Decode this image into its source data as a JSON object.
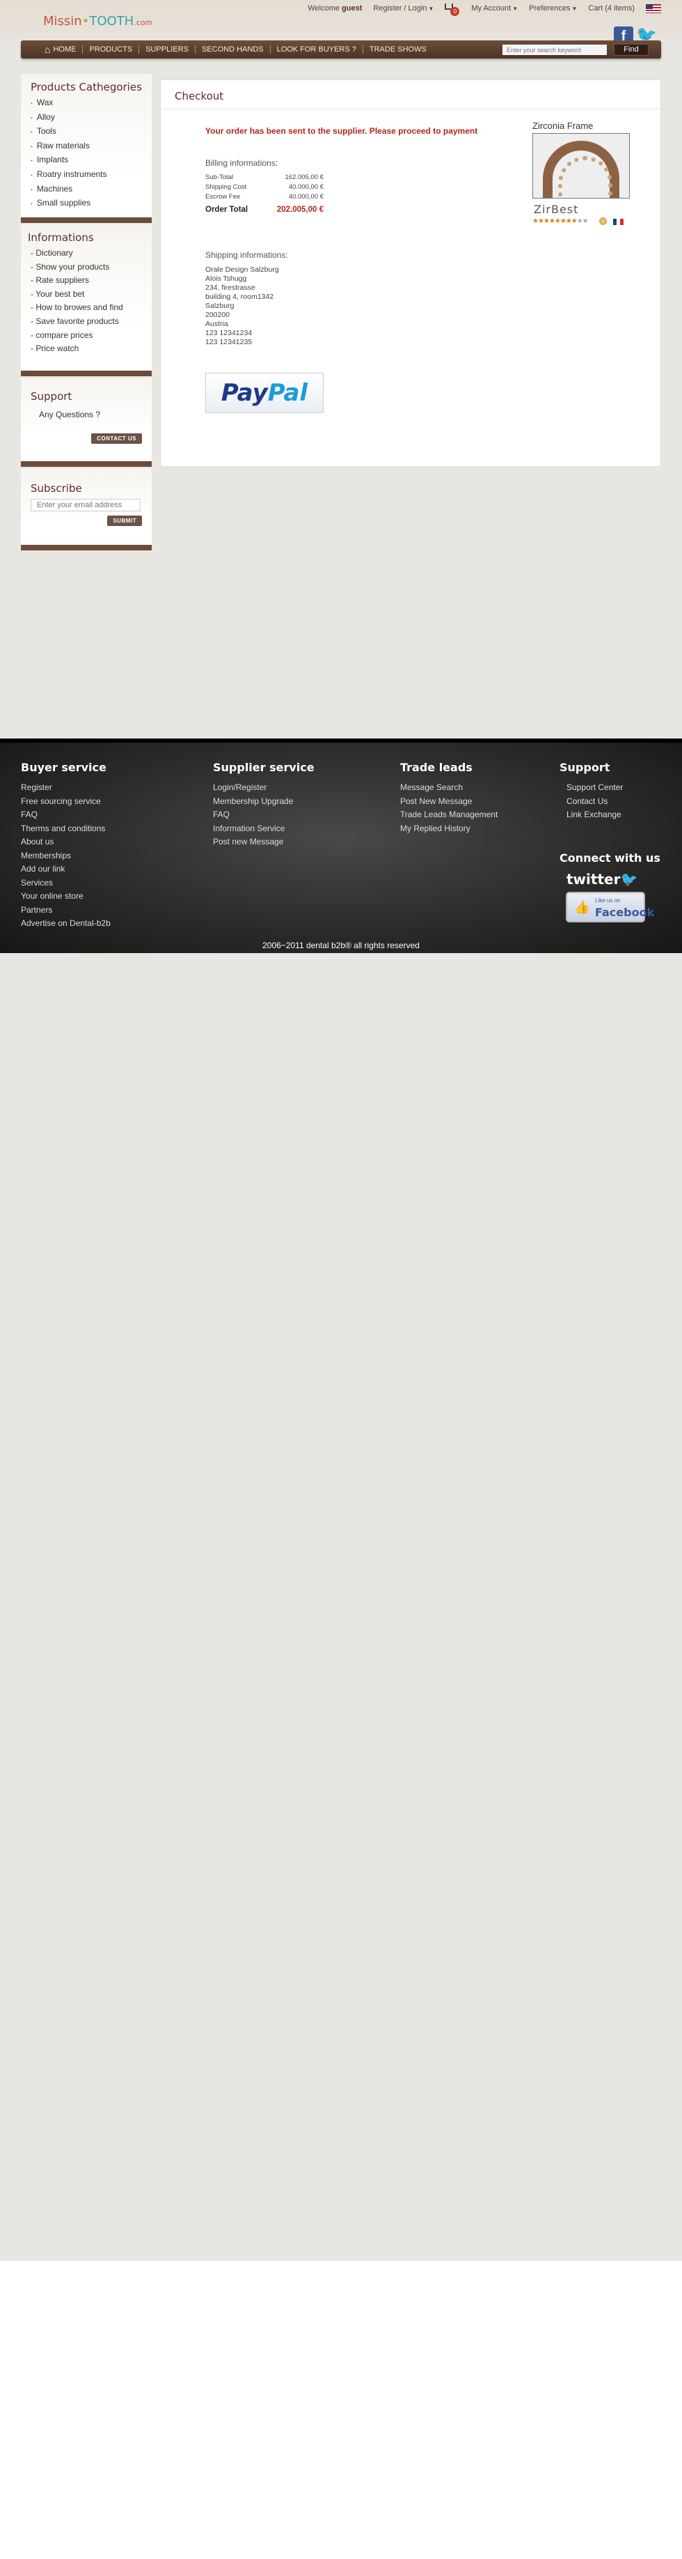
{
  "header": {
    "logo": {
      "part1": "Missin",
      "dot": "•",
      "part2": "TOOTH",
      "suffix": ".com"
    },
    "welcome_prefix": "Welcome",
    "welcome_user": "guest",
    "register_login": "Register / Login",
    "cart_badge": "0",
    "my_account": "My Account",
    "preferences": "Preferences",
    "cart": "Cart (4 items)",
    "fb_label": "f",
    "tw_label": "🐦"
  },
  "nav": {
    "home": "HOME",
    "items": [
      "PRODUCTS",
      "SUPPLIERS",
      "SECOND HANDS",
      "LOOK FOR BUYERS ?",
      "TRADE SHOWS"
    ],
    "search_placeholder": "Enter your search keyword",
    "find": "Find"
  },
  "sidebar": {
    "categories_title": "Products Cathegories",
    "categories": [
      "Wax",
      "Alloy",
      "Tools",
      "Raw materials",
      "Implants",
      "Roatry instruments",
      "Machines",
      "Small supplies"
    ],
    "info_title": "Informations",
    "info_items": [
      "- Dictionary",
      "- Show your products",
      "- Rate suppliers",
      "- Your best bet",
      "- How to browes and find",
      "- Save favorite products",
      "- compare prices",
      "- Price watch"
    ],
    "support_title": "Support",
    "support_question": "Any Questions ?",
    "contact_button": "CONTACT US",
    "subscribe_title": "Subscribe",
    "subscribe_placeholder": "Enter your email address",
    "submit_button": "SUBMIT"
  },
  "checkout": {
    "title": "Checkout",
    "message": "Your order has been sent to the supplier. Please proceed to payment",
    "billing_label": "Billing informations:",
    "billing": [
      {
        "label": "Sub-Total",
        "value": "162.005,00 €"
      },
      {
        "label": "Shipping Cost",
        "value": "40.000,00 €"
      },
      {
        "label": "Escrow Fee",
        "value": "40.000,00 €"
      }
    ],
    "total_label": "Order Total",
    "total_value": "202.005,00 €",
    "shipping_label": "Shipping informations:",
    "shipping_lines": [
      "Orale Design Salzburg",
      "Alois Tshugg",
      "234, firestrasse",
      "building 4, room1342",
      "Salzburg",
      "200200",
      "Austria",
      "123 12341234",
      "123 12341235"
    ],
    "paypal_part1": "Pay",
    "paypal_part2": "Pal"
  },
  "product": {
    "name": "Zirconia Frame",
    "brand": "ZirBest",
    "rating": 4
  },
  "footer": {
    "buyer_title": "Buyer service",
    "buyer_links": [
      "Register",
      "Free sourcing service",
      "FAQ",
      "Therms and conditions",
      "About us",
      "Memberships",
      "Add our link",
      "Services",
      "Your online store",
      "Partners",
      "Advertise on Dental-b2b"
    ],
    "supplier_title": "Supplier service",
    "supplier_links": [
      "Login/Register",
      "Membership Upgrade",
      "FAQ",
      "Information Service",
      "Post new Message"
    ],
    "trade_title": "Trade leads",
    "trade_links": [
      "Message Search",
      "Post New Message",
      "Trade Leads Management",
      "My Replied History"
    ],
    "support_title": "Support",
    "support_links": [
      "Support Center",
      "Contact Us",
      "Link Exchange"
    ],
    "connect_title": "Connect with us",
    "twitter": "twitter",
    "like_us_on": "Like us on",
    "facebook": "Facebook",
    "copyright": "2006~2011 dental b2b® all rights reserved"
  },
  "colors": {
    "brand_brown": "#5a2d28",
    "nav_bg": "#4b3426",
    "alert_red": "#b2261a",
    "page_bg": "#e8e6e1"
  }
}
